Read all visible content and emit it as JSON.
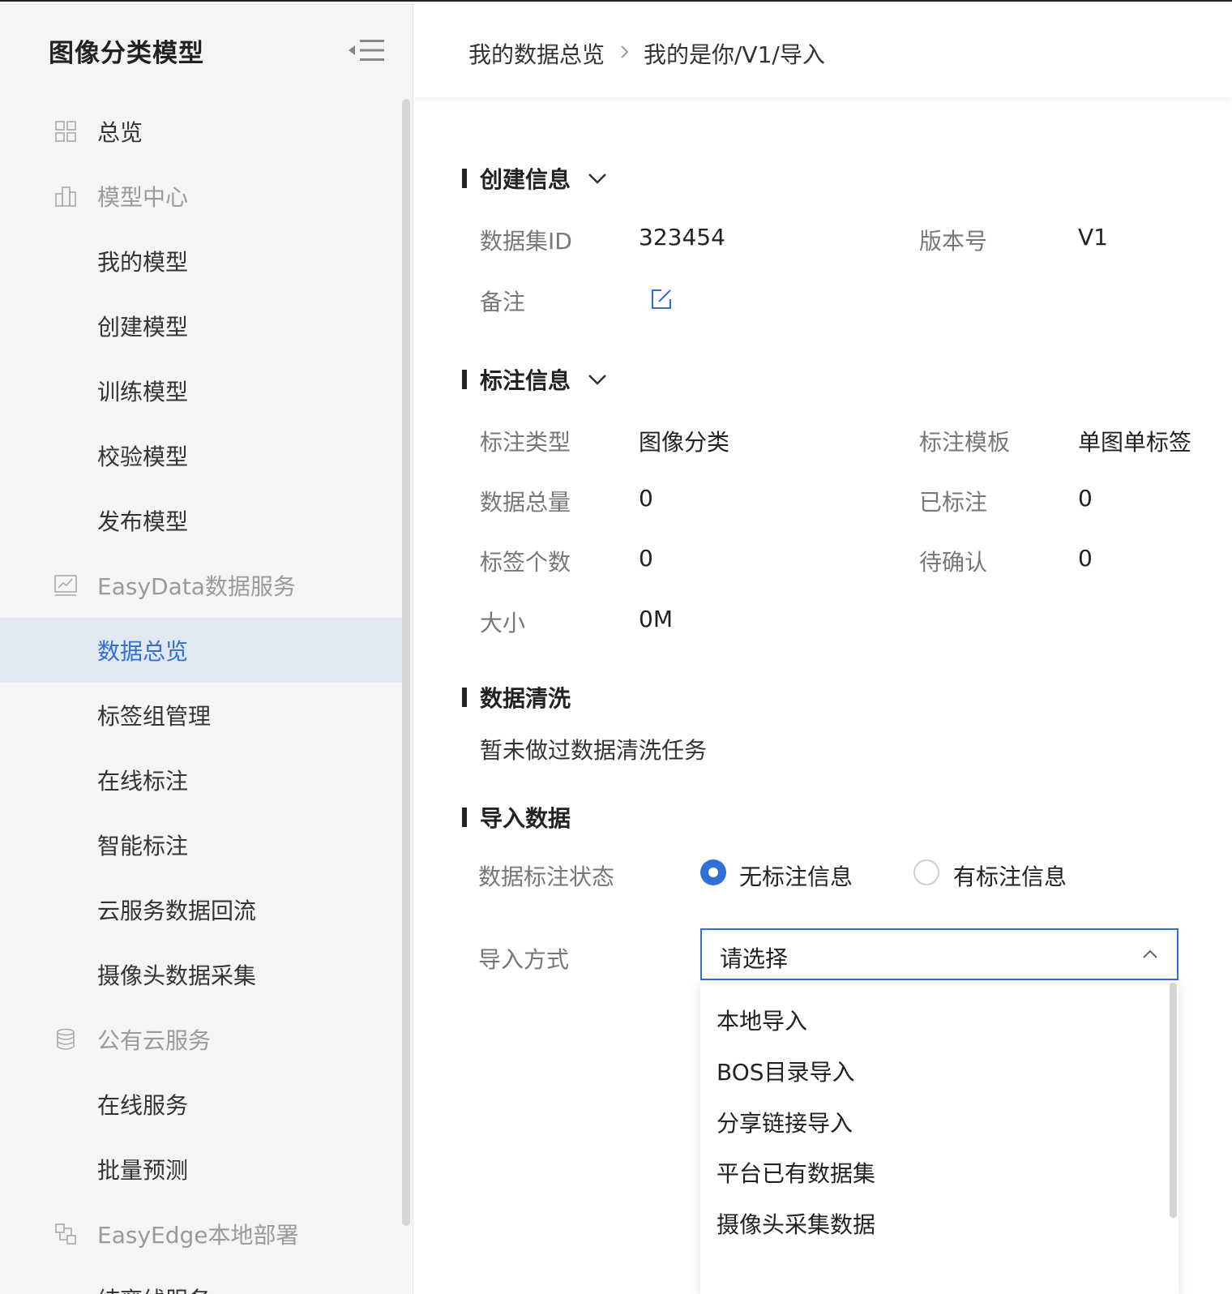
{
  "sidebar": {
    "title": "图像分类模型",
    "items": [
      {
        "label": "总览",
        "type": "item",
        "icon": "grid-icon"
      },
      {
        "label": "模型中心",
        "type": "group",
        "icon": "building-icon"
      },
      {
        "label": "我的模型",
        "type": "sub"
      },
      {
        "label": "创建模型",
        "type": "sub"
      },
      {
        "label": "训练模型",
        "type": "sub"
      },
      {
        "label": "校验模型",
        "type": "sub"
      },
      {
        "label": "发布模型",
        "type": "sub"
      },
      {
        "label": "EasyData数据服务",
        "type": "group",
        "icon": "chart-icon"
      },
      {
        "label": "数据总览",
        "type": "sub",
        "active": true
      },
      {
        "label": "标签组管理",
        "type": "sub"
      },
      {
        "label": "在线标注",
        "type": "sub"
      },
      {
        "label": "智能标注",
        "type": "sub"
      },
      {
        "label": "云服务数据回流",
        "type": "sub"
      },
      {
        "label": "摄像头数据采集",
        "type": "sub"
      },
      {
        "label": "公有云服务",
        "type": "group",
        "icon": "database-icon"
      },
      {
        "label": "在线服务",
        "type": "sub"
      },
      {
        "label": "批量预测",
        "type": "sub"
      },
      {
        "label": "EasyEdge本地部署",
        "type": "group",
        "icon": "deploy-icon"
      },
      {
        "label": "纯离线服务",
        "type": "sub"
      }
    ]
  },
  "breadcrumb": {
    "root": "我的数据总览",
    "current": "我的是你/V1/导入"
  },
  "create_info": {
    "title": "创建信息",
    "dataset_id_label": "数据集ID",
    "dataset_id": "323454",
    "version_label": "版本号",
    "version": "V1",
    "remark_label": "备注"
  },
  "annotation_info": {
    "title": "标注信息",
    "type_label": "标注类型",
    "type": "图像分类",
    "template_label": "标注模板",
    "template": "单图单标签",
    "total_label": "数据总量",
    "total": "0",
    "labeled_label": "已标注",
    "labeled": "0",
    "tag_count_label": "标签个数",
    "tag_count": "0",
    "pending_label": "待确认",
    "pending": "0",
    "size_label": "大小",
    "size": "0M"
  },
  "cleaning": {
    "title": "数据清洗",
    "empty_text": "暂未做过数据清洗任务"
  },
  "import": {
    "title": "导入数据",
    "status_label": "数据标注状态",
    "option_no_label": "无标注信息",
    "option_has_label": "有标注信息",
    "selected_status": "无标注信息",
    "method_label": "导入方式",
    "method_placeholder": "请选择",
    "method_options": [
      "本地导入",
      "BOS目录导入",
      "分享链接导入",
      "平台已有数据集",
      "摄像头采集数据"
    ]
  },
  "colors": {
    "accent": "#2f6fd6",
    "active_bg": "#e1e8f2",
    "sidebar_bg": "#f5f5f5"
  }
}
